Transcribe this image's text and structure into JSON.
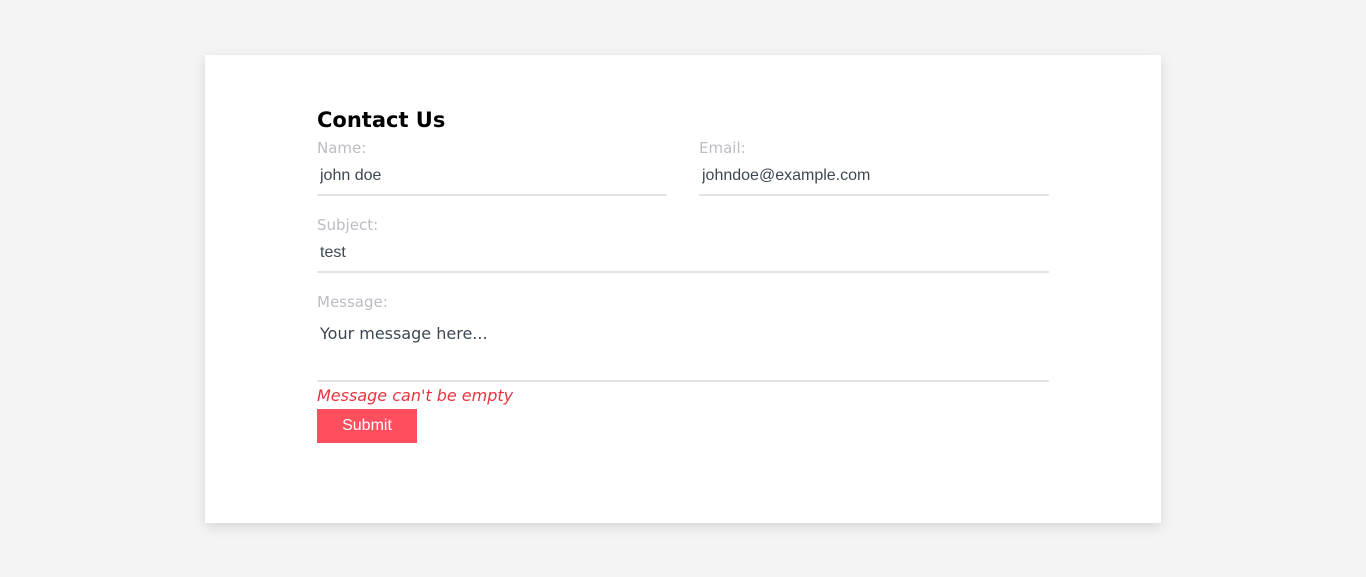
{
  "form": {
    "title": "Contact Us",
    "name": {
      "label": "Name:",
      "value": "john doe"
    },
    "email": {
      "label": "Email:",
      "value": "johndoe@example.com"
    },
    "subject": {
      "label": "Subject:",
      "value": "test"
    },
    "message": {
      "label": "Message:",
      "placeholder": "Your message here...",
      "value": ""
    },
    "error": "Message can't be empty",
    "submit_label": "Submit"
  },
  "colors": {
    "page_background": "#f4f4f4",
    "card_background": "#ffffff",
    "label": "#bcbcc4",
    "input_text": "#3d4752",
    "error": "#e8343f",
    "submit_background": "#ff4f5e"
  }
}
